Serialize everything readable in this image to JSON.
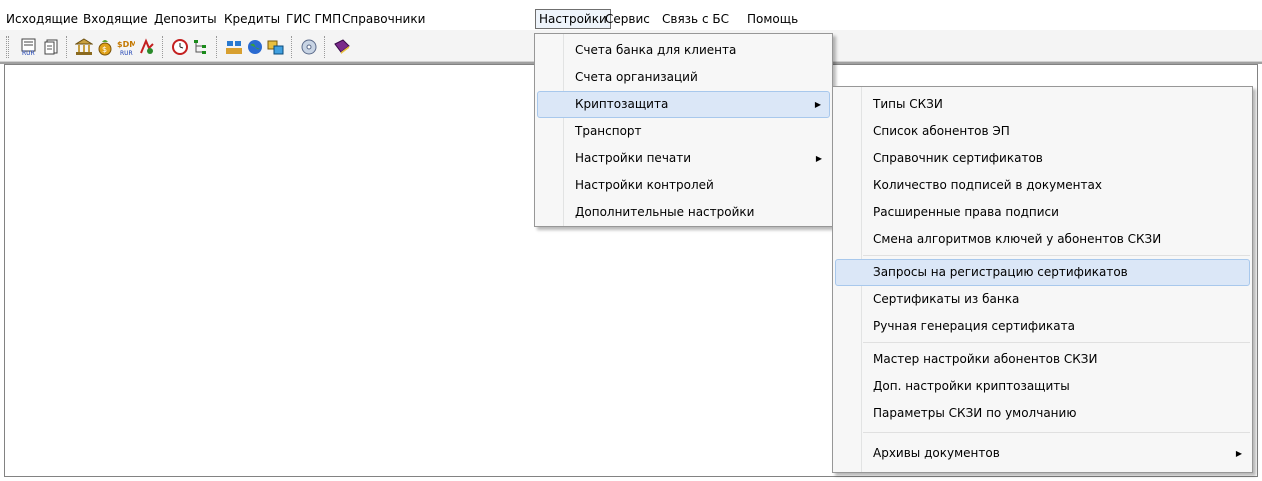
{
  "menubar": {
    "items": [
      "Исходящие",
      "Входящие",
      "Депозиты",
      "Кредиты",
      "ГИС ГМП",
      "Справочники",
      "Настройки",
      "Сервис",
      "Связь с БС",
      "Помощь"
    ]
  },
  "toolbar": {
    "icons": [
      "rur-document-icon",
      "copy-document-icon",
      "bank-icon",
      "deposit-icon",
      "currency-icon",
      "credit-icon",
      "clock-icon",
      "tree-icon",
      "users-icon",
      "globe-icon",
      "exchange-icon",
      "disk-icon",
      "book-icon"
    ]
  },
  "settings_menu": {
    "items": [
      {
        "label": "Счета банка для клиента",
        "submenu": false
      },
      {
        "label": "Счета организаций",
        "submenu": false
      },
      {
        "label": "Криптозащита",
        "submenu": true
      },
      {
        "label": "Транспорт",
        "submenu": false
      },
      {
        "label": "Настройки печати",
        "submenu": true
      },
      {
        "label": "Настройки контролей",
        "submenu": false
      },
      {
        "label": "Дополнительные настройки",
        "submenu": false
      }
    ]
  },
  "crypto_menu": {
    "items": [
      {
        "label": "Типы СКЗИ"
      },
      {
        "label": "Список абонентов ЭП"
      },
      {
        "label": "Справочник сертификатов"
      },
      {
        "label": "Количество подписей в документах"
      },
      {
        "label": "Расширенные права подписи"
      },
      {
        "label": "Смена алгоритмов ключей у абонентов СКЗИ"
      },
      {
        "label": "Запросы на регистрацию сертификатов"
      },
      {
        "label": "Сертификаты из банка"
      },
      {
        "label": "Ручная генерация сертификата"
      },
      {
        "label": "Мастер настройки абонентов СКЗИ"
      },
      {
        "label": "Доп. настройки криптозащиты"
      },
      {
        "label": "Параметры СКЗИ по умолчанию"
      },
      {
        "label": "Архивы документов",
        "submenu": true
      }
    ]
  },
  "colors": {
    "highlight": "#dbe7f7",
    "menu_bg": "#f7f7f7"
  }
}
